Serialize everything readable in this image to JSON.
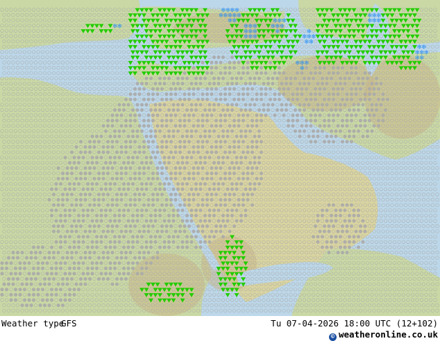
{
  "map": {
    "colors": {
      "sea": "#bcd7e9",
      "land_low": "#c9d8a4",
      "land_desert": "#d9d4a0",
      "mountain": "#c8b688",
      "clear": "#aaaaaa",
      "cloud": "#aaaaaa",
      "rain": "#22cc00",
      "snow": "#2a8cf0"
    },
    "symbols": [
      "clear-sky-icon",
      "cloudy-icon",
      "rain-icon",
      "snow-icon"
    ]
  },
  "footer": {
    "type_label": "Weather type",
    "model_label": "GFS",
    "time_label": "Tu 07-04-2026 18:00 UTC (12+102)",
    "brand_symbol": "©",
    "brand_label": "weatheronline.co.uk"
  }
}
